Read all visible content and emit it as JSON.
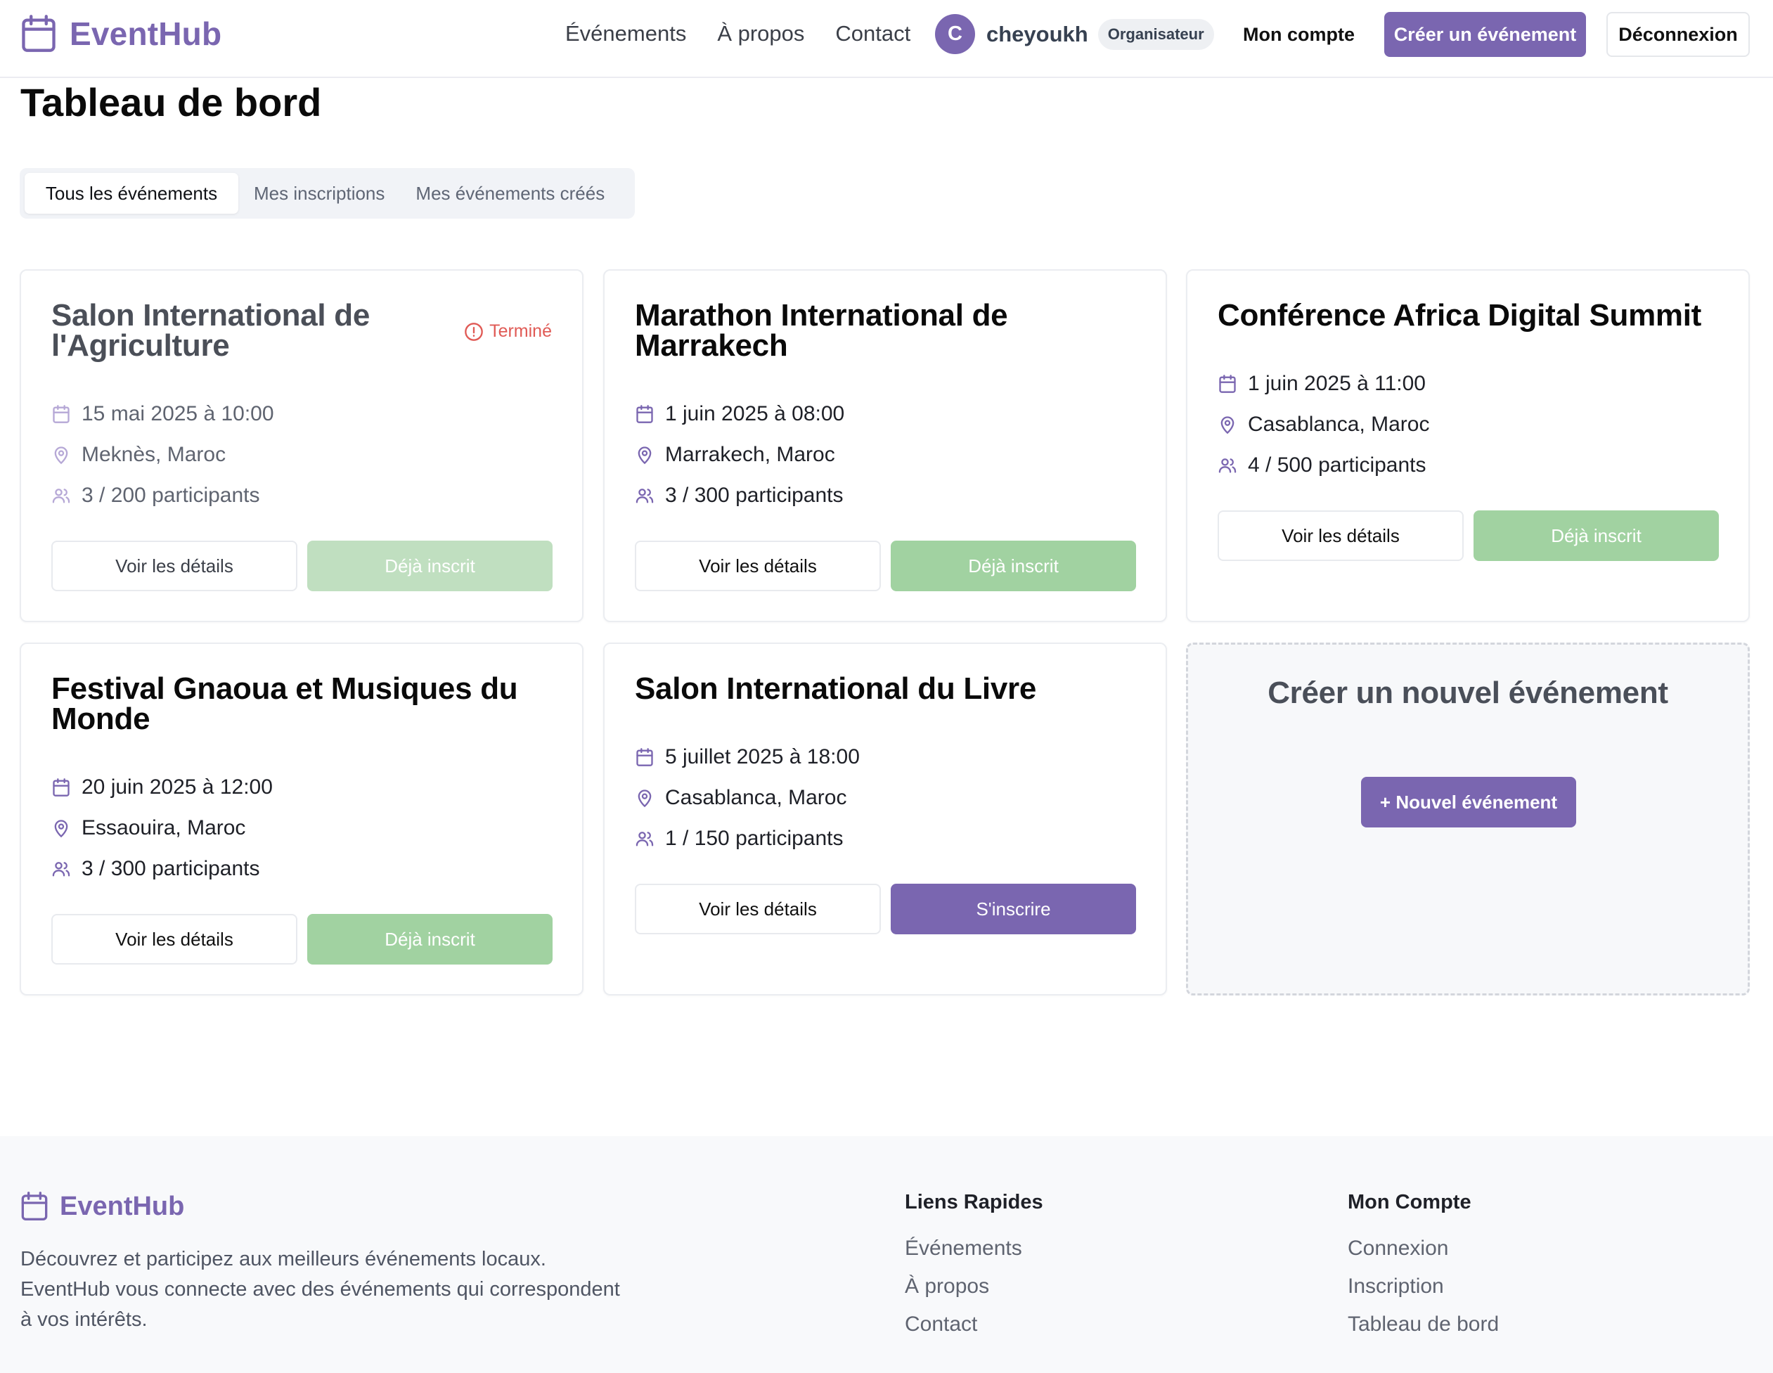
{
  "header": {
    "brand": "EventHub",
    "nav": [
      "Événements",
      "À propos",
      "Contact"
    ],
    "user": {
      "initial": "C",
      "name": "cheyoukh",
      "role": "Organisateur"
    },
    "account_label": "Mon compte",
    "create_label": "Créer un événement",
    "logout_label": "Déconnexion"
  },
  "page": {
    "title": "Tableau de bord",
    "tabs": [
      "Tous les événements",
      "Mes inscriptions",
      "Mes événements créés"
    ],
    "active_tab": "Tous les événements"
  },
  "events": [
    {
      "title": "Salon International de l'Agriculture",
      "status": "Terminé",
      "date": "15 mai 2025 à 10:00",
      "location": "Meknès, Maroc",
      "participants": "3 / 200 participants",
      "details_label": "Voir les détails",
      "action_label": "Déjà inscrit"
    },
    {
      "title": "Marathon International de Marrakech",
      "date": "1 juin 2025 à 08:00",
      "location": "Marrakech, Maroc",
      "participants": "3 / 300 participants",
      "details_label": "Voir les détails",
      "action_label": "Déjà inscrit"
    },
    {
      "title": "Conférence Africa Digital Summit",
      "date": "1 juin 2025 à 11:00",
      "location": "Casablanca, Maroc",
      "participants": "4 / 500 participants",
      "details_label": "Voir les détails",
      "action_label": "Déjà inscrit"
    },
    {
      "title": "Festival Gnaoua et Musiques du Monde",
      "date": "20 juin 2025 à 12:00",
      "location": "Essaouira, Maroc",
      "participants": "3 / 300 participants",
      "details_label": "Voir les détails",
      "action_label": "Déjà inscrit"
    },
    {
      "title": "Salon International du Livre",
      "date": "5 juillet 2025 à 18:00",
      "location": "Casablanca, Maroc",
      "participants": "1 / 150 participants",
      "details_label": "Voir les détails",
      "action_label": "S'inscrire"
    }
  ],
  "create_card": {
    "title": "Créer un nouvel événement",
    "button_label": "+ Nouvel événement"
  },
  "footer": {
    "brand": "EventHub",
    "description": "Découvrez et participez aux meilleurs événements locaux. EventHub vous connecte avec des événements qui correspondent à vos intérêts.",
    "quick_links": {
      "heading": "Liens Rapides",
      "items": [
        "Événements",
        "À propos",
        "Contact"
      ]
    },
    "account": {
      "heading": "Mon Compte",
      "items": [
        "Connexion",
        "Inscription",
        "Tableau de bord"
      ]
    }
  },
  "colors": {
    "accent": "#7a66b0",
    "registered": "#a1d2a1",
    "ended": "#e05a55"
  },
  "icons": {
    "brand": "calendar-icon",
    "date": "calendar-icon",
    "location": "map-pin-icon",
    "participants": "users-icon",
    "status": "alert-circle-icon"
  }
}
